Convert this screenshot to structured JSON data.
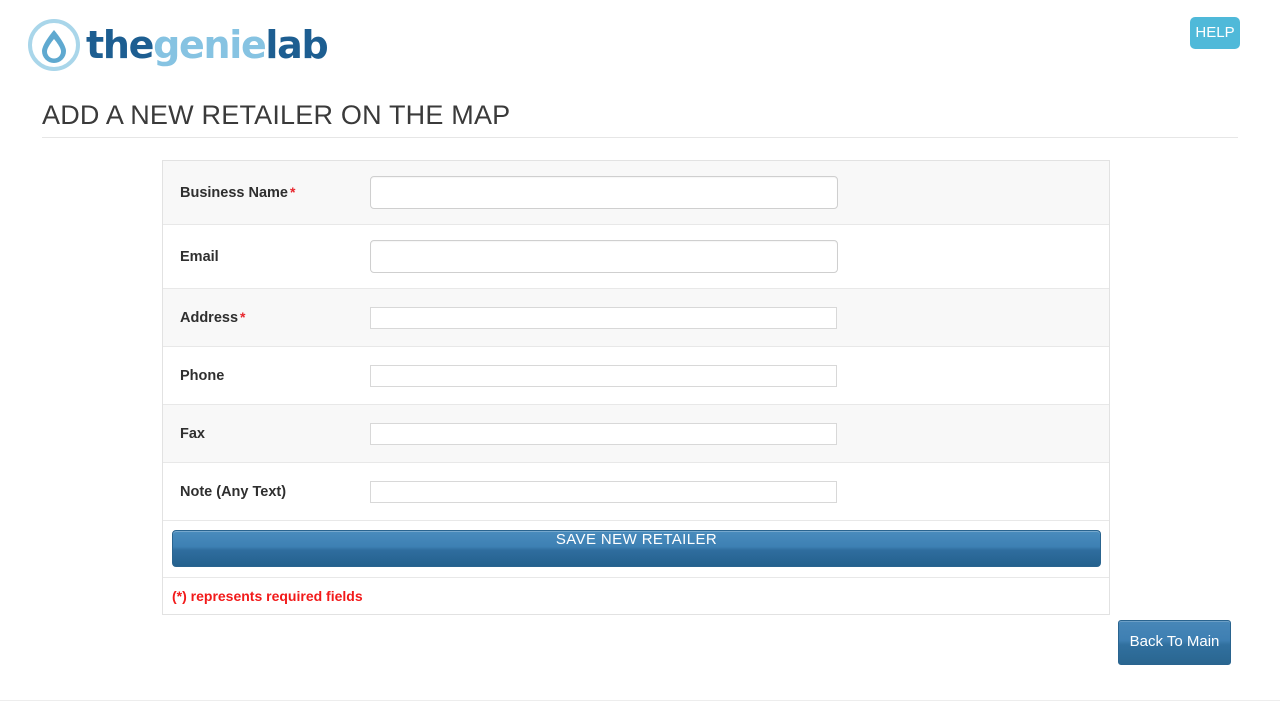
{
  "header": {
    "logo": {
      "icon": "water-droplet-circle-icon",
      "text_part1": "the",
      "text_part2": "genie",
      "text_part3": "lab",
      "color_dark": "#1d5e91",
      "color_light": "#86c3e2"
    },
    "help_label": "HELP",
    "help_color": "#4fb9d9"
  },
  "main": {
    "page_title": "ADD A NEW RETAILER ON THE MAP",
    "form": {
      "fields": [
        {
          "label": "Business Name",
          "required": true,
          "value": "",
          "placeholder": "",
          "input_style": "big"
        },
        {
          "label": "Email",
          "required": false,
          "value": "",
          "placeholder": "",
          "input_style": "big"
        },
        {
          "label": "Address",
          "required": true,
          "value": "",
          "placeholder": "",
          "input_style": "small"
        },
        {
          "label": "Phone",
          "required": false,
          "value": "",
          "placeholder": "",
          "input_style": "small"
        },
        {
          "label": "Fax",
          "required": false,
          "value": "",
          "placeholder": "",
          "input_style": "small"
        },
        {
          "label": "Note (Any Text)",
          "required": false,
          "value": "",
          "placeholder": "",
          "input_style": "small"
        }
      ],
      "required_marker": "*",
      "save_label": "SAVE NEW RETAILER",
      "required_note": "(*) represents required fields",
      "save_color": "#3d80b3",
      "note_color": "#f21a1a"
    },
    "back_label": "Back To Main"
  }
}
